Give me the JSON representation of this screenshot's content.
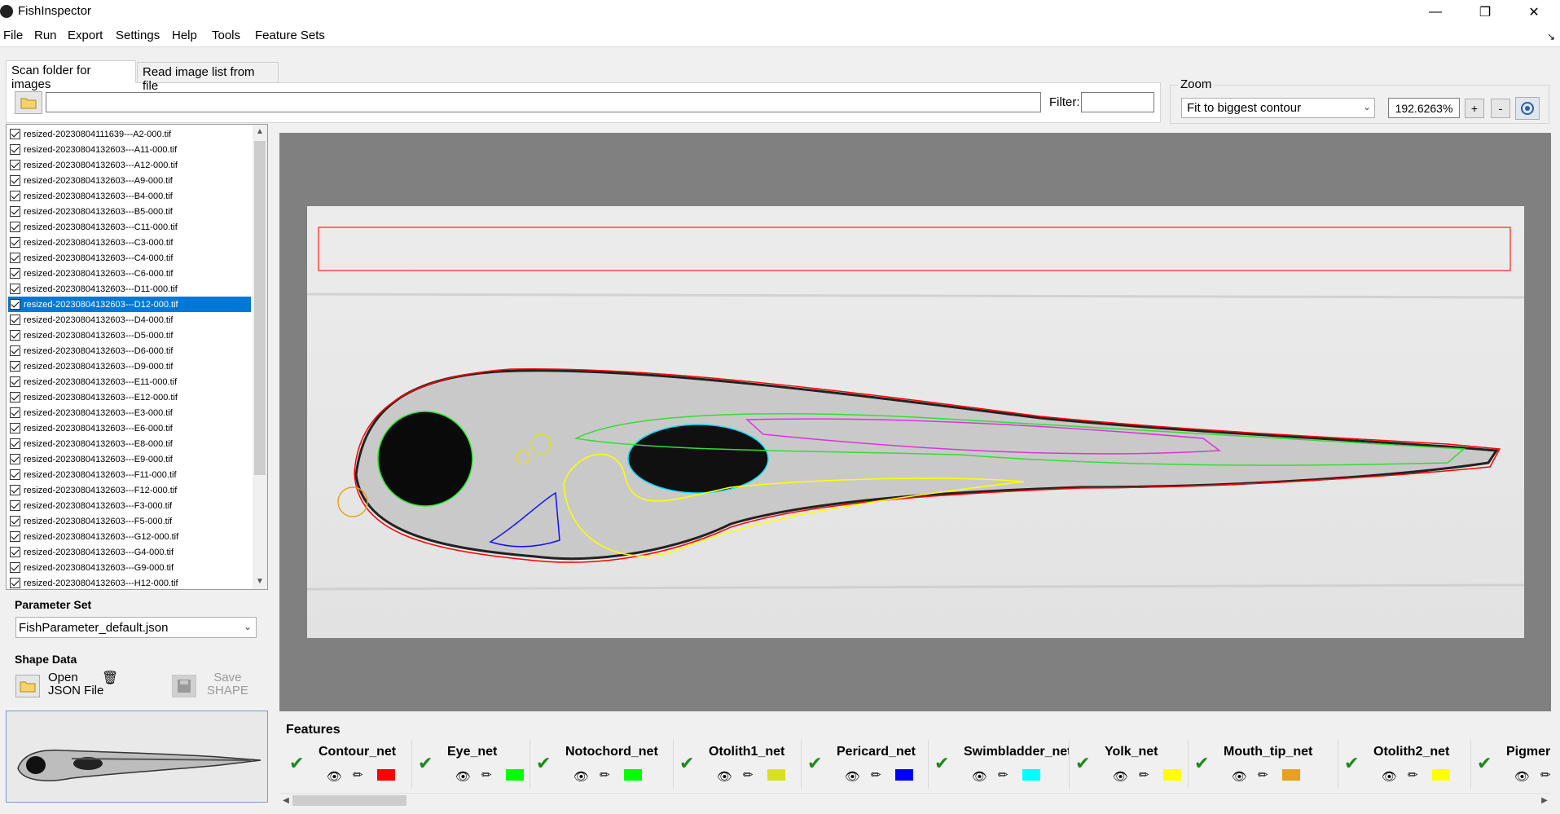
{
  "window": {
    "title": "FishInspector"
  },
  "menu": [
    "File",
    "Run",
    "Export",
    "Settings",
    "Help",
    "Tools",
    "Feature Sets"
  ],
  "tabs": [
    "Scan folder for images",
    "Read image list from file"
  ],
  "folder": {
    "path_value": "",
    "filter_label": "Filter:",
    "filter_value": ""
  },
  "zoom": {
    "label": "Zoom",
    "mode": "Fit to biggest contour",
    "value": "192.6263%",
    "plus": "+",
    "minus": "-"
  },
  "files": [
    "resized-20230804111639---A2-000.tif",
    "resized-20230804132603---A11-000.tif",
    "resized-20230804132603---A12-000.tif",
    "resized-20230804132603---A9-000.tif",
    "resized-20230804132603---B4-000.tif",
    "resized-20230804132603---B5-000.tif",
    "resized-20230804132603---C11-000.tif",
    "resized-20230804132603---C3-000.tif",
    "resized-20230804132603---C4-000.tif",
    "resized-20230804132603---C6-000.tif",
    "resized-20230804132603---D11-000.tif",
    "resized-20230804132603---D12-000.tif",
    "resized-20230804132603---D4-000.tif",
    "resized-20230804132603---D5-000.tif",
    "resized-20230804132603---D6-000.tif",
    "resized-20230804132603---D9-000.tif",
    "resized-20230804132603---E11-000.tif",
    "resized-20230804132603---E12-000.tif",
    "resized-20230804132603---E3-000.tif",
    "resized-20230804132603---E6-000.tif",
    "resized-20230804132603---E8-000.tif",
    "resized-20230804132603---E9-000.tif",
    "resized-20230804132603---F11-000.tif",
    "resized-20230804132603---F12-000.tif",
    "resized-20230804132603---F3-000.tif",
    "resized-20230804132603---F5-000.tif",
    "resized-20230804132603---G12-000.tif",
    "resized-20230804132603---G4-000.tif",
    "resized-20230804132603---G9-000.tif",
    "resized-20230804132603---H12-000.tif"
  ],
  "selected_file_index": 11,
  "parameter_set": {
    "title": "Parameter Set",
    "value": "FishParameter_default.json"
  },
  "shape_data": {
    "title": "Shape Data",
    "open_label_1": "Open",
    "open_label_2": "JSON File",
    "save_label_1": "Save",
    "save_label_2": "SHAPE"
  },
  "features": {
    "title": "Features",
    "items": [
      {
        "name": "Contour_net",
        "color": "#ff0000"
      },
      {
        "name": "Eye_net",
        "color": "#00ff00"
      },
      {
        "name": "Notochord_net",
        "color": "#00ff00"
      },
      {
        "name": "Otolith1_net",
        "color": "#d8e020"
      },
      {
        "name": "Pericard_net",
        "color": "#0000ff"
      },
      {
        "name": "Swimbladder_net",
        "color": "#00ffff"
      },
      {
        "name": "Yolk_net",
        "color": "#ffff00"
      },
      {
        "name": "Mouth_tip_net",
        "color": "#e8a020"
      },
      {
        "name": "Otolith2_net",
        "color": "#ffff00"
      },
      {
        "name": "Pigmer",
        "color": "#ff00ff"
      }
    ]
  }
}
